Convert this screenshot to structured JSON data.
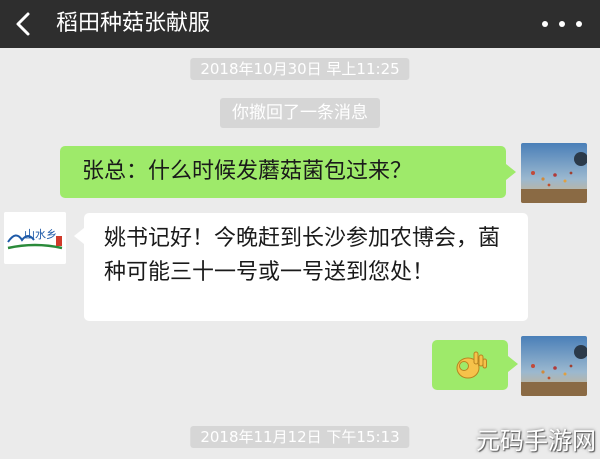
{
  "header": {
    "title": "稻田种菇张献服",
    "back_icon": "chevron-left-icon",
    "more_icon": "more-dots-icon"
  },
  "messages": {
    "timestamp_1": "2018年10月30日 早上11:25",
    "recall_notice": "你撤回了一条消息",
    "sent_1": "张总：什么时候发蘑菇菌包过来？",
    "received_1": "姚书记好！今晚赶到长沙参加农博会，菌种可能三十一号或一号送到您处！",
    "sent_2_sticker": "ok-hand-icon",
    "timestamp_2": "2018年11月12日 下午15:13"
  },
  "avatar_left_logo_text": "山水乡",
  "watermark": "元码手游网",
  "colors": {
    "header_bg": "#2e2e2e",
    "chat_bg": "#ebebeb",
    "sent_bubble": "#9eea6a",
    "received_bubble": "#ffffff",
    "system_chip": "#d6d6d6"
  }
}
